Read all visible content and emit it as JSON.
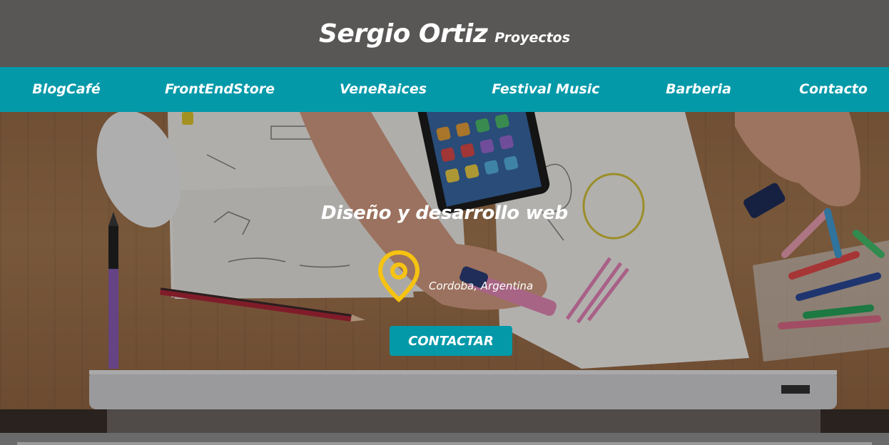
{
  "header": {
    "title": "Sergio Ortiz",
    "subtitle": "Proyectos"
  },
  "nav": {
    "items": [
      {
        "label": "BlogCafé"
      },
      {
        "label": "FrontEndStore"
      },
      {
        "label": "VeneRaices"
      },
      {
        "label": "Festival Music"
      },
      {
        "label": "Barberia"
      },
      {
        "label": "Contacto"
      }
    ]
  },
  "hero": {
    "heading": "Diseño y desarrollo web",
    "location": "Cordoba, Argentina",
    "location_icon": "map-pin-icon",
    "cta_label": "CONTACTAR"
  },
  "colors": {
    "header_bg": "#595656",
    "nav_bg": "#0499a9",
    "button_bg": "#0499a9",
    "pin_color": "#f6c312"
  }
}
